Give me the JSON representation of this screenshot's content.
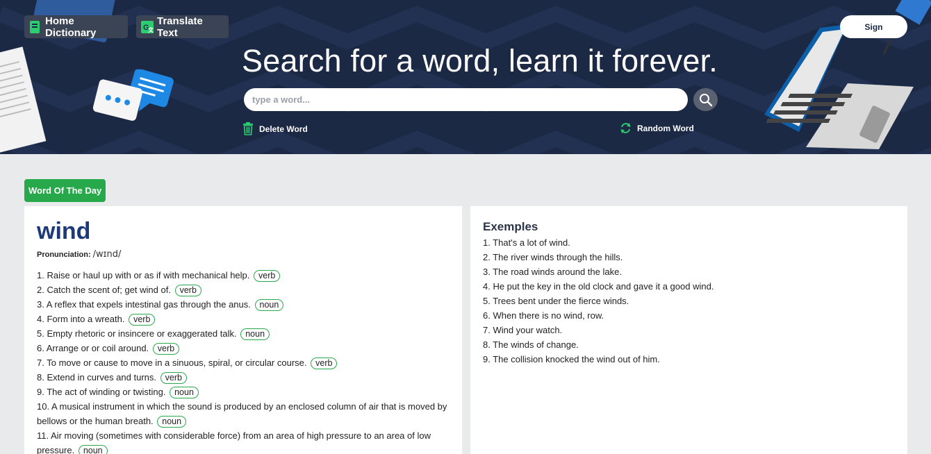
{
  "header": {
    "nav": [
      {
        "label": "Home Dictionary",
        "icon": "book-icon"
      },
      {
        "label": "Translate Text",
        "icon": "translate-icon"
      }
    ],
    "sign_label": "Sign",
    "headline": "Search for a word, learn it forever.",
    "search": {
      "placeholder": "type a word...",
      "value": ""
    },
    "actions": {
      "delete": "Delete Word",
      "random": "Random Word"
    }
  },
  "wotd": {
    "badge": "Word Of The Day",
    "word": "wind",
    "pron_label": "Pronunciation:",
    "pron_value": "/wɪnd/",
    "definitions": [
      {
        "n": "1.",
        "text": "Raise or haul up with or as if with mechanical help.",
        "pos": "verb"
      },
      {
        "n": "2.",
        "text": "Catch the scent of; get wind of.",
        "pos": "verb"
      },
      {
        "n": "3.",
        "text": "A reflex that expels intestinal gas through the anus.",
        "pos": "noun"
      },
      {
        "n": "4.",
        "text": "Form into a wreath.",
        "pos": "verb"
      },
      {
        "n": "5.",
        "text": "Empty rhetoric or insincere or exaggerated talk.",
        "pos": "noun"
      },
      {
        "n": "6.",
        "text": "Arrange or or coil around.",
        "pos": "verb"
      },
      {
        "n": "7.",
        "text": "To move or cause to move in a sinuous, spiral, or circular course.",
        "pos": "verb"
      },
      {
        "n": "8.",
        "text": "Extend in curves and turns.",
        "pos": "verb"
      },
      {
        "n": "9.",
        "text": "The act of winding or twisting.",
        "pos": "noun"
      },
      {
        "n": "10.",
        "text": "A musical instrument in which the sound is produced by an enclosed column of air that is moved by bellows or the human breath.",
        "pos": "noun"
      },
      {
        "n": "11.",
        "text": "Air moving (sometimes with considerable force) from an area of high pressure to an area of low pressure.",
        "pos": "noun"
      }
    ]
  },
  "examples": {
    "title": "Exemples",
    "items": [
      "1. That's a lot of wind.",
      "2. The river winds through the hills.",
      "3. The road winds around the lake.",
      "4. He put the key in the old clock and gave it a good wind.",
      "5. Trees bent under the fierce winds.",
      "6. When there is no wind, row.",
      "7. Wind your watch.",
      "8. The winds of change.",
      "9. The collision knocked the wind out of him."
    ]
  },
  "colors": {
    "header_bg": "#1c2945",
    "accent_green": "#27a84a",
    "word_blue": "#1c3a7a"
  }
}
